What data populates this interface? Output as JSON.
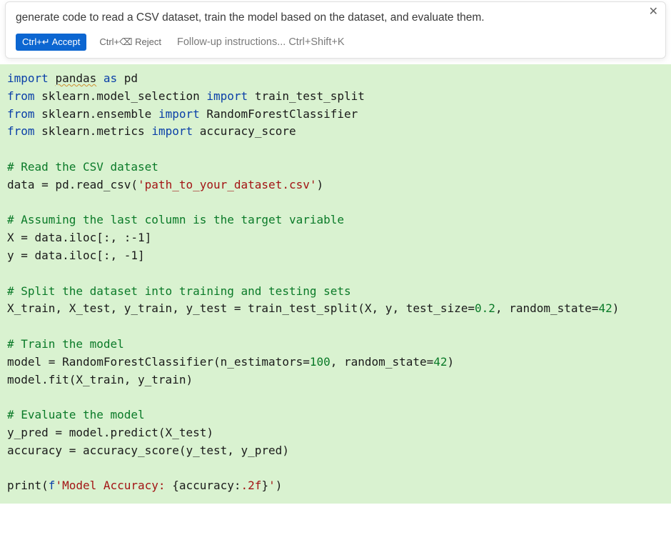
{
  "prompt": {
    "text": "generate code to read a CSV dataset, train the model based on the dataset, and evaluate them.",
    "accept_label": "Ctrl+↵ Accept",
    "reject_label": "Ctrl+⌫ Reject",
    "followup_placeholder": "Follow-up instructions... Ctrl+Shift+K",
    "close_symbol": "✕"
  },
  "code": {
    "tokens": [
      {
        "t": "kw",
        "v": "import"
      },
      {
        "t": "sp",
        "v": " "
      },
      {
        "t": "mod squiggle",
        "v": "pandas"
      },
      {
        "t": "sp",
        "v": " "
      },
      {
        "t": "kw",
        "v": "as"
      },
      {
        "t": "sp",
        "v": " "
      },
      {
        "t": "mod",
        "v": "pd"
      },
      {
        "t": "nl"
      },
      {
        "t": "kw",
        "v": "from"
      },
      {
        "t": "sp",
        "v": " "
      },
      {
        "t": "mod",
        "v": "sklearn.model_selection"
      },
      {
        "t": "sp",
        "v": " "
      },
      {
        "t": "kw",
        "v": "import"
      },
      {
        "t": "sp",
        "v": " "
      },
      {
        "t": "fn",
        "v": "train_test_split"
      },
      {
        "t": "nl"
      },
      {
        "t": "kw",
        "v": "from"
      },
      {
        "t": "sp",
        "v": " "
      },
      {
        "t": "mod",
        "v": "sklearn.ensemble"
      },
      {
        "t": "sp",
        "v": " "
      },
      {
        "t": "kw",
        "v": "import"
      },
      {
        "t": "sp",
        "v": " "
      },
      {
        "t": "cls",
        "v": "RandomForestClassifier"
      },
      {
        "t": "nl"
      },
      {
        "t": "kw",
        "v": "from"
      },
      {
        "t": "sp",
        "v": " "
      },
      {
        "t": "mod",
        "v": "sklearn.metrics"
      },
      {
        "t": "sp",
        "v": " "
      },
      {
        "t": "kw",
        "v": "import"
      },
      {
        "t": "sp",
        "v": " "
      },
      {
        "t": "fn",
        "v": "accuracy_score"
      },
      {
        "t": "nl"
      },
      {
        "t": "nl"
      },
      {
        "t": "com",
        "v": "# Read the CSV dataset"
      },
      {
        "t": "nl"
      },
      {
        "t": "mod",
        "v": "data = pd.read_csv("
      },
      {
        "t": "str",
        "v": "'path_to_your_dataset.csv'"
      },
      {
        "t": "mod",
        "v": ")"
      },
      {
        "t": "nl"
      },
      {
        "t": "nl"
      },
      {
        "t": "com",
        "v": "# Assuming the last column is the target variable"
      },
      {
        "t": "nl"
      },
      {
        "t": "mod",
        "v": "X = data.iloc[:, :"
      },
      {
        "t": "mod",
        "v": "-1"
      },
      {
        "t": "mod",
        "v": "]"
      },
      {
        "t": "nl"
      },
      {
        "t": "mod",
        "v": "y = data.iloc[:, "
      },
      {
        "t": "mod",
        "v": "-1"
      },
      {
        "t": "mod",
        "v": "]"
      },
      {
        "t": "nl"
      },
      {
        "t": "nl"
      },
      {
        "t": "com",
        "v": "# Split the dataset into training and testing sets"
      },
      {
        "t": "nl"
      },
      {
        "t": "mod",
        "v": "X_train, X_test, y_train, y_test = train_test_split(X, y, test_size="
      },
      {
        "t": "num",
        "v": "0.2"
      },
      {
        "t": "mod",
        "v": ", random_state="
      },
      {
        "t": "num",
        "v": "42"
      },
      {
        "t": "mod",
        "v": ")"
      },
      {
        "t": "nl"
      },
      {
        "t": "nl"
      },
      {
        "t": "com",
        "v": "# Train the model"
      },
      {
        "t": "nl"
      },
      {
        "t": "mod",
        "v": "model = RandomForestClassifier(n_estimators="
      },
      {
        "t": "num",
        "v": "100"
      },
      {
        "t": "mod",
        "v": ", random_state="
      },
      {
        "t": "num",
        "v": "42"
      },
      {
        "t": "mod",
        "v": ")"
      },
      {
        "t": "nl"
      },
      {
        "t": "mod",
        "v": "model.fit(X_train, y_train)"
      },
      {
        "t": "nl"
      },
      {
        "t": "nl"
      },
      {
        "t": "com",
        "v": "# Evaluate the model"
      },
      {
        "t": "nl"
      },
      {
        "t": "mod",
        "v": "y_pred = model.predict(X_test)"
      },
      {
        "t": "nl"
      },
      {
        "t": "mod",
        "v": "accuracy = accuracy_score(y_test, y_pred)"
      },
      {
        "t": "nl"
      },
      {
        "t": "nl"
      },
      {
        "t": "mod",
        "v": "print("
      },
      {
        "t": "kw",
        "v": "f"
      },
      {
        "t": "str",
        "v": "'Model Accuracy: "
      },
      {
        "t": "mod",
        "v": "{accuracy:"
      },
      {
        "t": "str",
        "v": ".2f"
      },
      {
        "t": "mod",
        "v": "}"
      },
      {
        "t": "str",
        "v": "'"
      },
      {
        "t": "mod",
        "v": ")"
      }
    ]
  }
}
